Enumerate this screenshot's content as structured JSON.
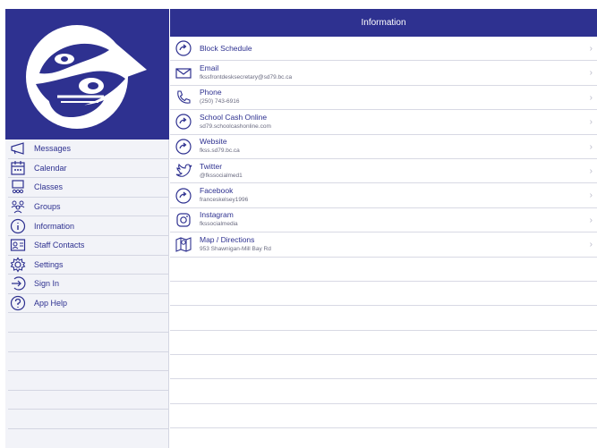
{
  "colors": {
    "brand": "#2e3190",
    "sidebar_bg": "#f2f3f8",
    "text": "#2e3190",
    "subtext": "#6a6b80"
  },
  "header": {
    "title": "Information"
  },
  "sidebar": {
    "items": [
      {
        "label": "Messages",
        "icon": "megaphone-icon"
      },
      {
        "label": "Calendar",
        "icon": "calendar-icon"
      },
      {
        "label": "Classes",
        "icon": "classes-icon"
      },
      {
        "label": "Groups",
        "icon": "groups-icon"
      },
      {
        "label": "Information",
        "icon": "info-icon"
      },
      {
        "label": "Staff Contacts",
        "icon": "contact-card-icon"
      },
      {
        "label": "Settings",
        "icon": "gear-icon"
      },
      {
        "label": "Sign In",
        "icon": "sign-in-icon"
      },
      {
        "label": "App Help",
        "icon": "help-icon"
      }
    ]
  },
  "info_list": [
    {
      "title": "Block Schedule",
      "sub": "",
      "icon": "share-arrow-icon"
    },
    {
      "title": "Email",
      "sub": "fkssfrontdesksecretary@sd79.bc.ca",
      "icon": "envelope-icon"
    },
    {
      "title": "Phone",
      "sub": "(250) 743-6916",
      "icon": "phone-icon"
    },
    {
      "title": "School Cash Online",
      "sub": "sd79.schoolcashonline.com",
      "icon": "share-arrow-icon"
    },
    {
      "title": "Website",
      "sub": "fkss.sd79.bc.ca",
      "icon": "share-arrow-icon"
    },
    {
      "title": "Twitter",
      "sub": "@fkssocialmed1",
      "icon": "twitter-icon"
    },
    {
      "title": "Facebook",
      "sub": "franceskelsey1996",
      "icon": "share-arrow-icon"
    },
    {
      "title": "Instagram",
      "sub": "fkssocialmedia",
      "icon": "instagram-icon"
    },
    {
      "title": "Map / Directions",
      "sub": "953 Shawnigan-Mill Bay Rd",
      "icon": "map-pin-icon"
    }
  ],
  "chevron": "›"
}
